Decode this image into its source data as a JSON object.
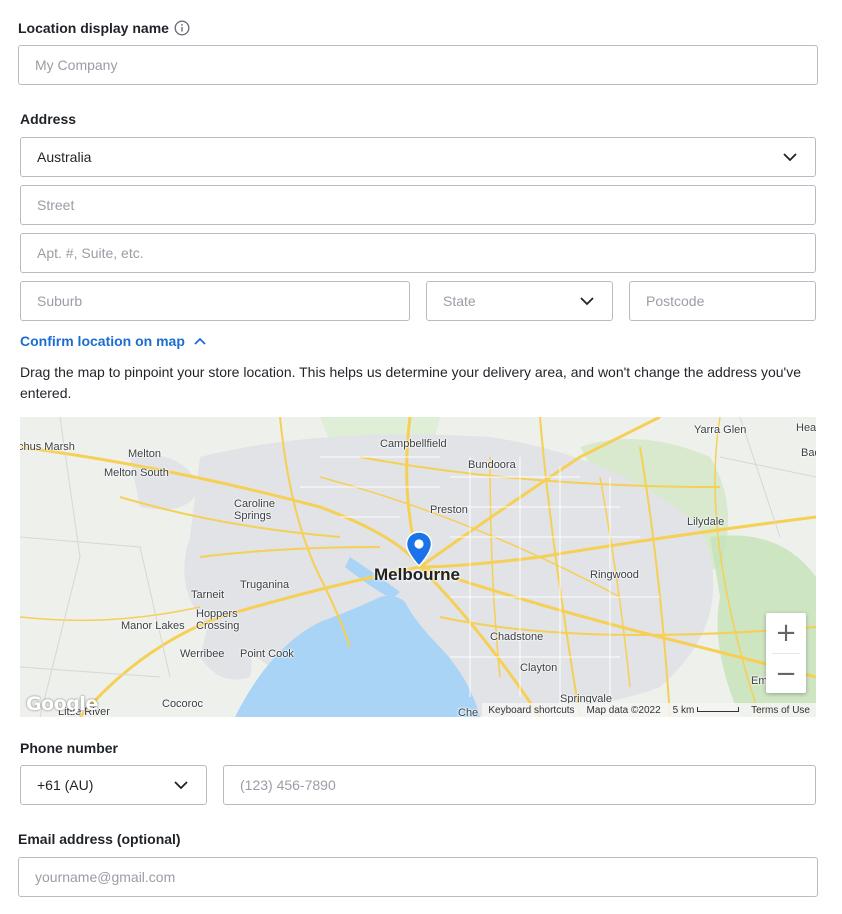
{
  "location": {
    "label": "Location display name",
    "info_icon": "info-icon",
    "placeholder": "My Company"
  },
  "address": {
    "label": "Address",
    "country": "Australia",
    "street_placeholder": "Street",
    "apt_placeholder": "Apt. #, Suite, etc.",
    "suburb_placeholder": "Suburb",
    "state_placeholder": "State",
    "postcode_placeholder": "Postcode"
  },
  "map_section": {
    "toggle_label": "Confirm location on map",
    "toggle_icon": "chevron-up-icon",
    "description": "Drag the map to pinpoint your store location. This helps us determine your delivery area, and won't change the address you've entered."
  },
  "map": {
    "city": "Melbourne",
    "towns": [
      "chus Marsh",
      "Melton",
      "Melton South",
      "Campbellfield",
      "Bundoora",
      "Yarra Glen",
      "Hea",
      "Bad",
      "Caroline Springs",
      "Preston",
      "Lilydale",
      "Truganina",
      "Ringwood",
      "Tarneit",
      "Hoppers Crossing",
      "Manor Lakes",
      "Chadstone",
      "Werribee",
      "Point Cook",
      "Clayton",
      "Cocoroc",
      "Little River",
      "Springvale",
      "Che",
      "Em"
    ],
    "logo": "Google",
    "attribution": {
      "shortcuts": "Keyboard shortcuts",
      "map_data": "Map data ©2022",
      "scale": "5 km",
      "terms": "Terms of Use"
    },
    "zoom_in": "+",
    "zoom_out": "−",
    "colors": {
      "water": "#a9d4f5",
      "land": "#eef0ec",
      "urban": "#e1e3e6",
      "road": "#f6cf55",
      "park": "#cfe6c2",
      "pin": "#1a73e8"
    }
  },
  "phone": {
    "label": "Phone number",
    "country_code": "+61 (AU)",
    "placeholder": "(123) 456-7890"
  },
  "email": {
    "label": "Email address (optional)",
    "placeholder": "yourname@gmail.com"
  }
}
